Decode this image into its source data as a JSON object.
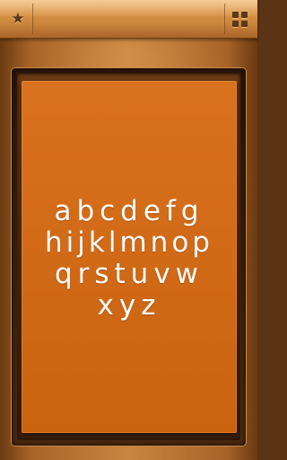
{
  "topbar": {
    "left_icon": "star-icon",
    "right_icon": "grid-icon"
  },
  "alphabet": {
    "lines": [
      "abcdefg",
      "hijklmnop",
      "qrstuvw",
      "xyz"
    ]
  },
  "colors": {
    "card": "#d16a17",
    "text": "#ffffff",
    "wood": "#a86428"
  }
}
